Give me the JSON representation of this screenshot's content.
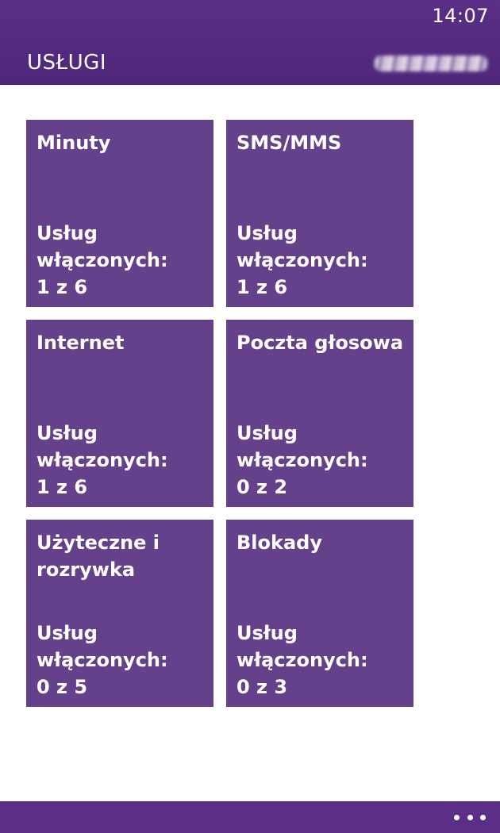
{
  "status_bar": {
    "time": "14:07"
  },
  "header": {
    "title": "USŁUGI",
    "account_obscured": true
  },
  "tiles": [
    {
      "title": "Minuty",
      "status_label_1": "Usług",
      "status_label_2": "włączonych:",
      "count": "1 z 6"
    },
    {
      "title": "SMS/MMS",
      "status_label_1": "Usług",
      "status_label_2": "włączonych:",
      "count": "1 z 6"
    },
    {
      "title": "Internet",
      "status_label_1": "Usług",
      "status_label_2": "włączonych:",
      "count": "1 z 6"
    },
    {
      "title": "Poczta głosowa",
      "status_label_1": "Usług",
      "status_label_2": "włączonych:",
      "count": "0 z 2"
    },
    {
      "title": "Użyteczne i rozrywka",
      "status_label_1": "Usług",
      "status_label_2": "włączonych:",
      "count": "0 z 5"
    },
    {
      "title": "Blokady",
      "status_label_1": "Usług",
      "status_label_2": "włączonych:",
      "count": "0 z 3"
    }
  ],
  "app_bar": {
    "more_icon": "ellipsis-icon"
  },
  "colors": {
    "header_bg": "#5a2f86",
    "tile_bg": "#66418b",
    "app_bar_bg": "#5b2f87",
    "text": "#ffffff"
  }
}
